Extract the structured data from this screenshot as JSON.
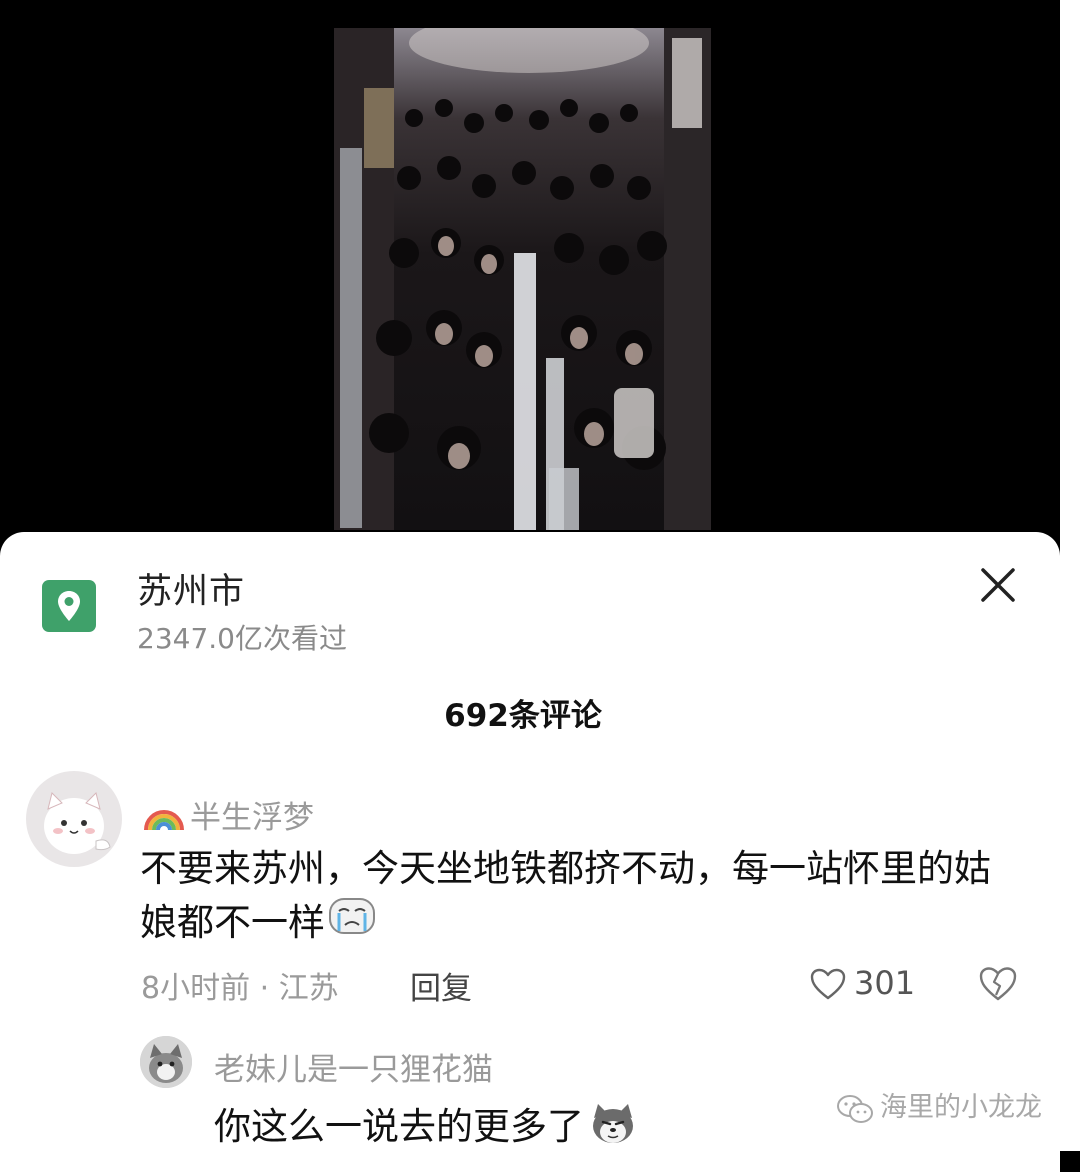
{
  "location": {
    "title": "苏州市",
    "views": "2347.0亿次看过",
    "icon": "map-pin-icon",
    "accent_color": "#3fa16a"
  },
  "comments_header": {
    "count_label": "692条评论"
  },
  "comment": {
    "username": "半生浮梦",
    "text": "不要来苏州，今天坐地铁都挤不动，每一站怀里的姑娘都不一样",
    "meta": "8小时前 · 江苏",
    "reply_label": "回复",
    "like_count": "301"
  },
  "reply": {
    "username": "老妹儿是一只狸花猫",
    "text": "你这么一说去的更多了"
  },
  "watermark": {
    "text": "海里的小龙龙"
  }
}
